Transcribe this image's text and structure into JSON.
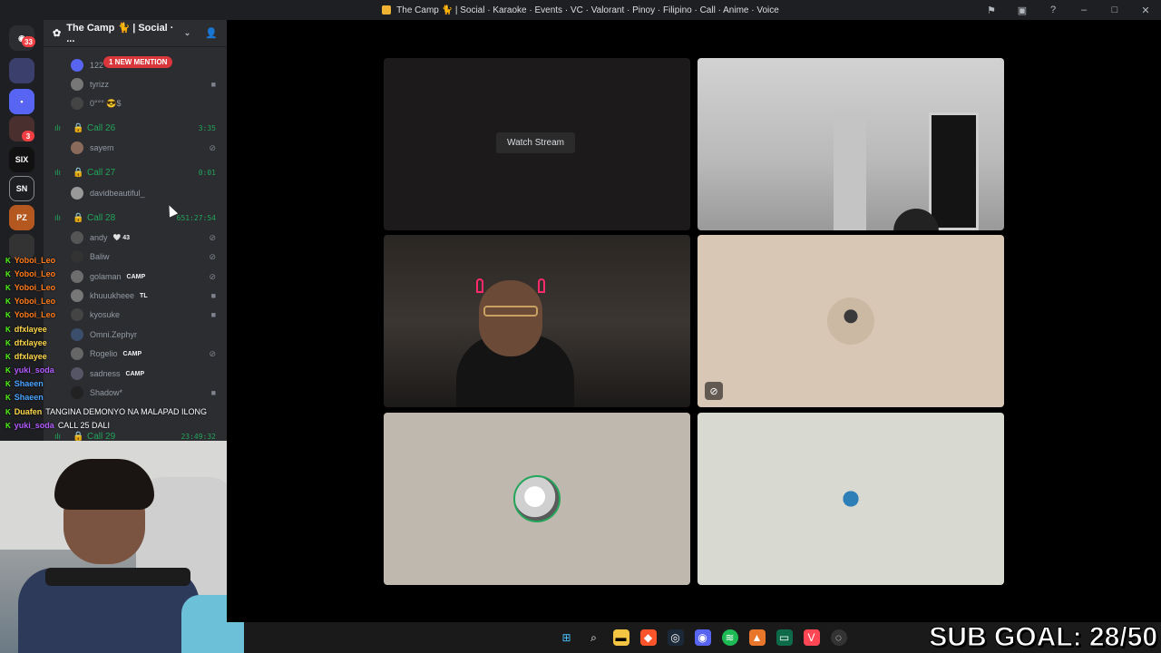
{
  "window": {
    "title": "The Camp 🐈 | Social · Karaoke · Events · VC · Valorant · Pinoy · Filipino · Call · Anime · Voice"
  },
  "rail": {
    "home_badge": "33",
    "badges": [
      "3",
      "3"
    ]
  },
  "server": {
    "name": "The Camp 🐈 | Social · ...",
    "mention_banner": "1 NEW MENTION"
  },
  "channel_rows": [
    {
      "type": "user",
      "name": "122",
      "icon": "discord-icon"
    },
    {
      "type": "user",
      "name": "tyrizz",
      "icon": "camera-icon"
    },
    {
      "type": "user",
      "name": "0°°° 😎$",
      "icon": ""
    },
    {
      "type": "call",
      "name": "Call 26",
      "time": "3:35"
    },
    {
      "type": "user",
      "name": "sayem",
      "icon": "deafen-icon"
    },
    {
      "type": "call",
      "name": "Call 27",
      "time": "0:01"
    },
    {
      "type": "user",
      "name": "davidbeautiful_",
      "icon": ""
    },
    {
      "type": "call",
      "name": "Call 28",
      "time": "651:27:54"
    },
    {
      "type": "user",
      "name": "andy",
      "extra": "🤍 43",
      "icon": "deafen-icon"
    },
    {
      "type": "user",
      "name": "Baliw",
      "icon": "deafen-icon"
    },
    {
      "type": "user",
      "name": "golaman",
      "tag": "CAMP",
      "icon": "deafen-icon"
    },
    {
      "type": "user",
      "name": "khuuukheee",
      "tag": "TL",
      "icon": "camera-icon"
    },
    {
      "type": "user",
      "name": "kyosuke",
      "icon": "camera-icon"
    },
    {
      "type": "user",
      "name": "Omni.Zephyr",
      "icon": ""
    },
    {
      "type": "user",
      "name": "Rogelio",
      "tag": "CAMP",
      "icon": "deafen-icon"
    },
    {
      "type": "user",
      "name": "sadness",
      "tag": "CAMP",
      "icon": ""
    },
    {
      "type": "user",
      "name": "Shadow*",
      "icon": "camera-icon"
    },
    {
      "type": "call",
      "name": "Call 29",
      "time": "23:49:32"
    }
  ],
  "chat": [
    {
      "user": "Yoboi_Leo",
      "color": "#ff7a1a",
      "text": ""
    },
    {
      "user": "Yoboi_Leo",
      "color": "#ff7a1a",
      "text": ""
    },
    {
      "user": "Yoboi_Leo",
      "color": "#ff7a1a",
      "text": ""
    },
    {
      "user": "Yoboi_Leo",
      "color": "#ff7a1a",
      "text": ""
    },
    {
      "user": "Yoboi_Leo",
      "color": "#ff7a1a",
      "text": ""
    },
    {
      "user": "dfxlayee",
      "color": "#ffd84a",
      "text": ""
    },
    {
      "user": "dfxlayee",
      "color": "#ffd84a",
      "text": ""
    },
    {
      "user": "dfxlayee",
      "color": "#ffd84a",
      "text": ""
    },
    {
      "user": "yuki_soda",
      "color": "#b25cff",
      "text": ""
    },
    {
      "user": "Shaeen",
      "color": "#4aa3ff",
      "text": ""
    },
    {
      "user": "Shaeen",
      "color": "#4aa3ff",
      "text": ""
    },
    {
      "user": "Duafen",
      "color": "#ffd84a",
      "text": "TANGINA DEMONYO NA MALAPAD ILONG"
    },
    {
      "user": "yuki_soda",
      "color": "#b25cff",
      "text": "CALL 25 DALI"
    }
  ],
  "stage": {
    "watch_stream_label": "Watch Stream"
  },
  "overlay": {
    "sub_goal": "SUB GOAL: 28/50"
  },
  "taskbar": {
    "icons": [
      "windows-start-icon",
      "search-icon",
      "file-explorer-icon",
      "brave-browser-icon",
      "steam-icon",
      "discord-icon",
      "spotify-icon",
      "app-icon",
      "terminal-icon",
      "valorant-icon",
      "app-icon"
    ]
  }
}
